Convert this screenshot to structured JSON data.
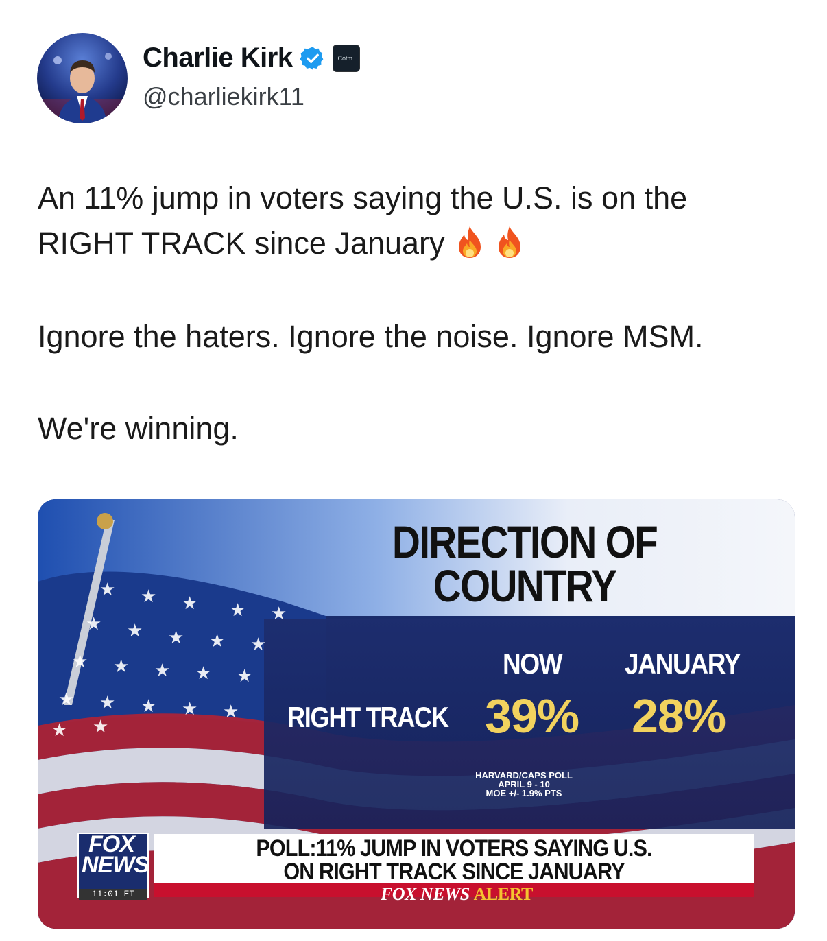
{
  "author": {
    "display_name": "Charlie Kirk",
    "handle": "@charliekirk11",
    "verified": true,
    "verified_icon": "verified-badge-icon",
    "affiliation_badge_text": "Cotm."
  },
  "tweet": {
    "line1": "An 11% jump in voters saying the U.S. is on the",
    "line2": "RIGHT TRACK since January",
    "emoji": [
      "fire",
      "fire"
    ],
    "line3": "Ignore the haters. Ignore the noise. Ignore MSM.",
    "line4": "We're winning."
  },
  "media": {
    "headline_line1": "DIRECTION OF",
    "headline_line2": "COUNTRY",
    "col_now": "NOW",
    "col_january": "JANUARY",
    "row_label": "RIGHT TRACK",
    "value_now": "39%",
    "value_january": "28%",
    "source_line1": "HARVARD/CAPS POLL",
    "source_line2": "APRIL 9 - 10",
    "source_line3": "MOE +/- 1.9% PTS",
    "ticker_line1": "POLL:11% JUMP IN VOTERS SAYING U.S.",
    "ticker_line2": "ON RIGHT TRACK SINCE JANUARY",
    "alert_fox": "FOX NEWS",
    "alert_word": "ALERT",
    "logo_line1": "FOX",
    "logo_line2": "NEWS",
    "clock": "11:01 ET",
    "colors": {
      "navy": "#1d2d6e",
      "gold": "#f2d25e",
      "red": "#c8102e"
    }
  }
}
